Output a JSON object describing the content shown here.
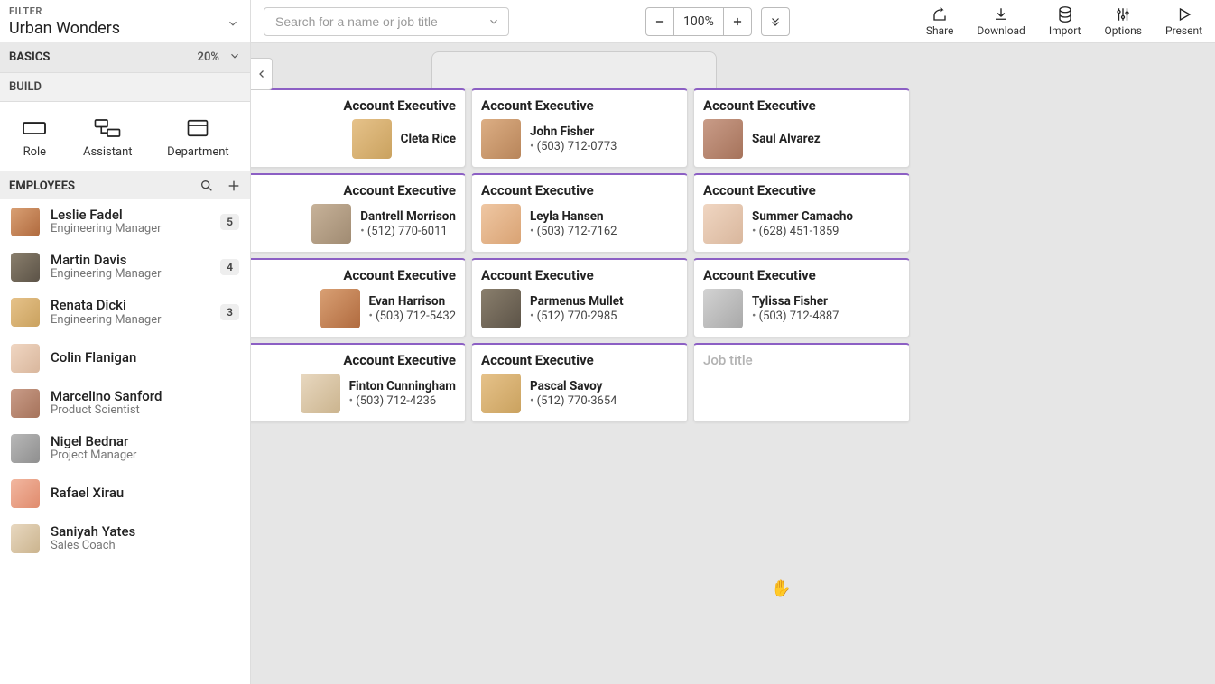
{
  "filter": {
    "label": "FILTER",
    "value": "Urban Wonders"
  },
  "sections": {
    "basics": "BASICS",
    "basics_pct": "20%",
    "build": "BUILD",
    "employees": "EMPLOYEES"
  },
  "tools": {
    "role": "Role",
    "assistant": "Assistant",
    "department": "Department"
  },
  "topbar": {
    "search_placeholder": "Search for a name or job title",
    "zoom": "100%",
    "actions": {
      "share": "Share",
      "download": "Download",
      "import": "Import",
      "options": "Options",
      "present": "Present"
    }
  },
  "employees": [
    {
      "name": "Leslie Fadel",
      "title": "Engineering Manager",
      "badge": "5",
      "av": "av-a"
    },
    {
      "name": "Martin Davis",
      "title": "Engineering Manager",
      "badge": "4",
      "av": "av-b"
    },
    {
      "name": "Renata Dicki",
      "title": "Engineering Manager",
      "badge": "3",
      "av": "av-c"
    },
    {
      "name": "Colin Flanigan",
      "title": "",
      "badge": "",
      "av": "av-d"
    },
    {
      "name": "Marcelino Sanford",
      "title": "Product Scientist",
      "badge": "",
      "av": "av-e"
    },
    {
      "name": "Nigel Bednar",
      "title": "Project Manager",
      "badge": "",
      "av": "av-f"
    },
    {
      "name": "Rafael Xirau",
      "title": "",
      "badge": "",
      "av": "av-g"
    },
    {
      "name": "Saniyah Yates",
      "title": "Sales Coach",
      "badge": "",
      "av": "av-h"
    }
  ],
  "cards": [
    [
      {
        "title": "Account Executive",
        "name": "Cleta Rice",
        "phone": "",
        "av": "av-c",
        "clipped": true
      },
      {
        "title": "Account Executive",
        "name": "John Fisher",
        "phone": "(503) 712-0773",
        "av": "av-i"
      },
      {
        "title": "Account Executive",
        "name": "Saul Alvarez",
        "phone": "",
        "av": "av-e"
      }
    ],
    [
      {
        "title": "Account Executive",
        "name": "Dantrell Morrison",
        "phone": "(512) 770-6011",
        "av": "av-j",
        "clipped": true
      },
      {
        "title": "Account Executive",
        "name": "Leyla Hansen",
        "phone": "(503) 712-7162",
        "av": "av-k"
      },
      {
        "title": "Account Executive",
        "name": "Summer Camacho",
        "phone": "(628) 451-1859",
        "av": "av-d"
      }
    ],
    [
      {
        "title": "Account Executive",
        "name": "Evan Harrison",
        "phone": "(503) 712-5432",
        "av": "av-a",
        "clipped": true
      },
      {
        "title": "Account Executive",
        "name": "Parmenus Mullet",
        "phone": "(512) 770-2985",
        "av": "av-b"
      },
      {
        "title": "Account Executive",
        "name": "Tylissa Fisher",
        "phone": "(503) 712-4887",
        "av": "av-l"
      }
    ],
    [
      {
        "title": "Account Executive",
        "name": "Finton Cunningham",
        "phone": "(503) 712-4236",
        "av": "av-h",
        "clipped": true
      },
      {
        "title": "Account Executive",
        "name": "Pascal Savoy",
        "phone": "(512) 770-3654",
        "av": "av-c"
      },
      {
        "title": "Job title",
        "name": "",
        "phone": "",
        "av": "",
        "placeholder": true
      }
    ]
  ]
}
